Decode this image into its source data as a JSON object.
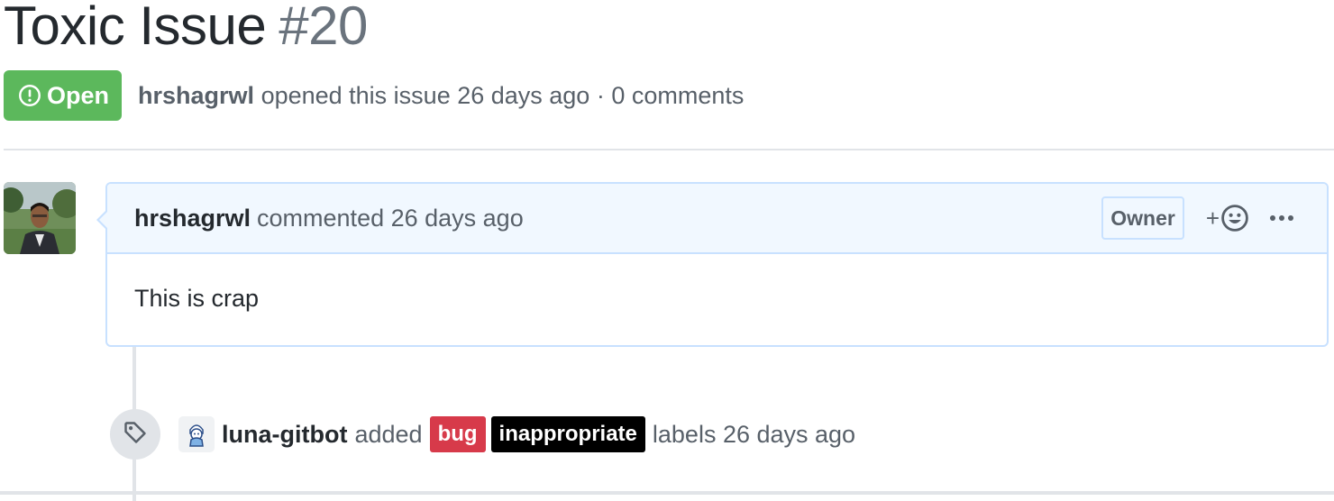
{
  "issue": {
    "title": "Toxic Issue",
    "number": "#20",
    "state_label": "Open",
    "author": "hrshagrwl",
    "meta_rest": "opened this issue 26 days ago · 0 comments"
  },
  "comment": {
    "author": "hrshagrwl",
    "action": "commented 26 days ago",
    "role_badge": "Owner",
    "reaction_plus": "+",
    "body": "This is crap"
  },
  "event": {
    "actor": "luna-gitbot",
    "verb": "added",
    "labels": [
      {
        "name": "bug",
        "color": "#d73a4a"
      },
      {
        "name": "inappropriate",
        "color": "#000000"
      }
    ],
    "tail": "labels 26 days ago"
  },
  "colors": {
    "open_state": "#5cb85c",
    "comment_border": "#c8e1ff",
    "comment_header_bg": "#f1f8ff"
  },
  "icons": {
    "state": "issue-opened-icon",
    "reaction": "smiley-icon",
    "more": "kebab-horizontal-icon",
    "event": "tag-icon"
  }
}
